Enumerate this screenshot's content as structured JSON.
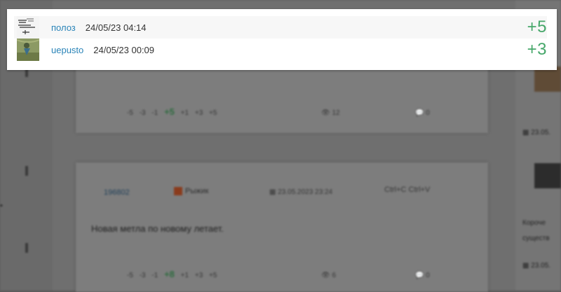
{
  "popup": {
    "rows": [
      {
        "user": "полоз",
        "time": "24/05/23 04:14",
        "vote": "+5",
        "avatar": "avatar-image"
      },
      {
        "user": "uepusto",
        "time": "24/05/23 00:09",
        "vote": "+3",
        "avatar": "avatar-image"
      }
    ]
  },
  "background": {
    "card1": {
      "votes": [
        "-5",
        "-3",
        "-1",
        "+5",
        "+1",
        "+3",
        "+5"
      ],
      "views": "12",
      "comments": "0"
    },
    "card2": {
      "id": "196802",
      "author": "Рыжик",
      "date": "23.05.2023 23:24",
      "shortcut": "Ctrl+C Ctrl+V",
      "text": "Новая метла по новому летает.",
      "votes": [
        "-5",
        "-3",
        "-1",
        "+8",
        "+1",
        "+3",
        "+5"
      ],
      "views": "6",
      "comments": "0"
    },
    "sidebar": {
      "date1": "23.05.",
      "text1": "Короче",
      "text2": "существ",
      "date2": "23.05."
    }
  },
  "colors": {
    "username": "#2a84b8",
    "vote_positive": "#46a76a",
    "overlay": "#6f6f6f"
  }
}
